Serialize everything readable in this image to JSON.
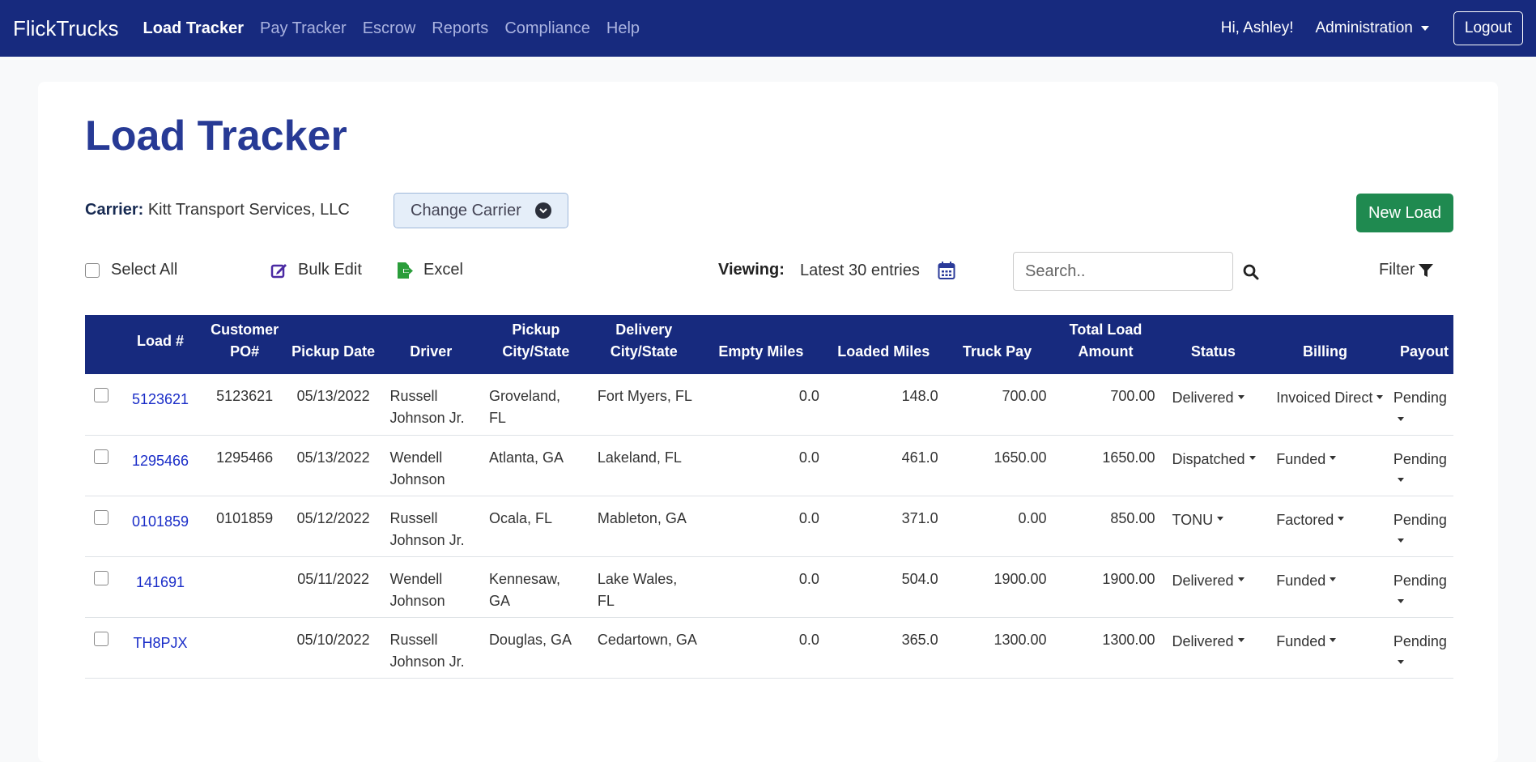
{
  "nav": {
    "brand": "FlickTrucks",
    "links": [
      "Load Tracker",
      "Pay Tracker",
      "Escrow",
      "Reports",
      "Compliance",
      "Help"
    ],
    "greeting": "Hi, Ashley!",
    "admin": "Administration",
    "logout": "Logout"
  },
  "page": {
    "title": "Load Tracker",
    "carrier_label": "Carrier:",
    "carrier_name": "Kitt Transport Services, LLC",
    "change_carrier": "Change Carrier",
    "new_load": "New Load"
  },
  "toolbar": {
    "select_all": "Select All",
    "bulk_edit": "Bulk Edit",
    "excel": "Excel",
    "viewing_label": "Viewing:",
    "viewing_value": "Latest 30 entries",
    "search_placeholder": "Search..",
    "filter": "Filter"
  },
  "table": {
    "headers": {
      "load": "Load #",
      "po1": "Customer",
      "po2": "PO#",
      "pickup_date": "Pickup Date",
      "driver": "Driver",
      "pickup1": "Pickup",
      "pickup2": "City/State",
      "delivery1": "Delivery",
      "delivery2": "City/State",
      "empty": "Empty Miles",
      "loaded": "Loaded Miles",
      "truck_pay": "Truck Pay",
      "total1": "Total Load",
      "total2": "Amount",
      "status": "Status",
      "billing": "Billing",
      "payout": "Payout"
    },
    "rows": [
      {
        "load": "5123621",
        "po": "5123621",
        "date": "05/13/2022",
        "driver1": "Russell",
        "driver2": "Johnson Jr.",
        "pickup1": "Groveland,",
        "pickup2": "FL",
        "delivery": "Fort Myers, FL",
        "empty": "0.0",
        "loaded": "148.0",
        "truck_pay": "700.00",
        "total": "700.00",
        "status": "Delivered",
        "billing": "Invoiced Direct",
        "payout": "Pending"
      },
      {
        "load": "1295466",
        "po": "1295466",
        "date": "05/13/2022",
        "driver1": "Wendell",
        "driver2": "Johnson",
        "pickup1": "Atlanta, GA",
        "pickup2": "",
        "delivery": "Lakeland, FL",
        "empty": "0.0",
        "loaded": "461.0",
        "truck_pay": "1650.00",
        "total": "1650.00",
        "status": "Dispatched",
        "billing": "Funded",
        "payout": "Pending"
      },
      {
        "load": "0101859",
        "po": "0101859",
        "date": "05/12/2022",
        "driver1": "Russell",
        "driver2": "Johnson Jr.",
        "pickup1": "Ocala, FL",
        "pickup2": "",
        "delivery": "Mableton, GA",
        "empty": "0.0",
        "loaded": "371.0",
        "truck_pay": "0.00",
        "total": "850.00",
        "status": "TONU",
        "billing": "Factored",
        "payout": "Pending"
      },
      {
        "load": "141691",
        "po": "",
        "date": "05/11/2022",
        "driver1": "Wendell",
        "driver2": "Johnson",
        "pickup1": "Kennesaw,",
        "pickup2": "GA",
        "delivery": "Lake Wales, FL",
        "empty": "0.0",
        "loaded": "504.0",
        "truck_pay": "1900.00",
        "total": "1900.00",
        "status": "Delivered",
        "billing": "Funded",
        "payout": "Pending"
      },
      {
        "load": "TH8PJX",
        "po": "",
        "date": "05/10/2022",
        "driver1": "Russell",
        "driver2": "Johnson Jr.",
        "pickup1": "Douglas, GA",
        "pickup2": "",
        "delivery": "Cedartown, GA",
        "empty": "0.0",
        "loaded": "365.0",
        "truck_pay": "1300.00",
        "total": "1300.00",
        "status": "Delivered",
        "billing": "Funded",
        "payout": "Pending"
      }
    ]
  },
  "colors": {
    "navbar": "#172a7e",
    "title": "#273a95",
    "new_load_button": "#1f8a50",
    "link": "#1a2dc8"
  }
}
